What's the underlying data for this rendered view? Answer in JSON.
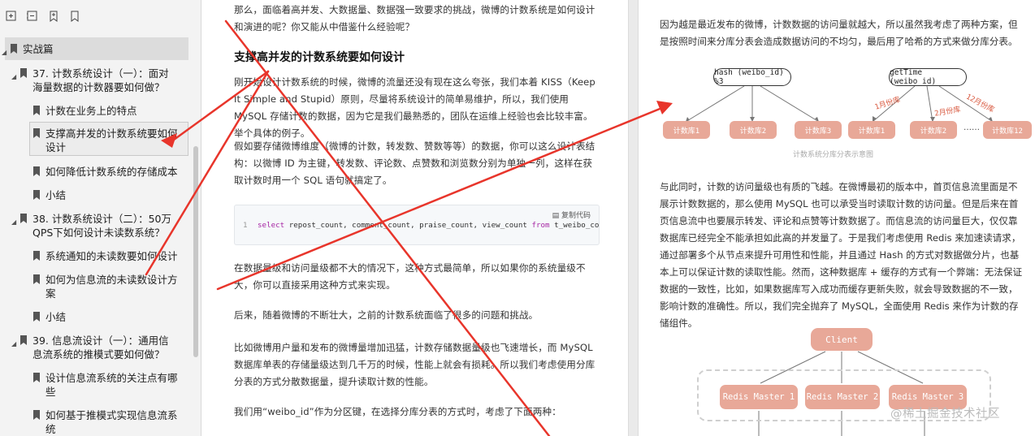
{
  "sidebar": {
    "toolbar": [
      "expand-all-icon",
      "collapse-all-icon",
      "add-bookmark-icon",
      "bookmark-icon"
    ],
    "section": "实战篇",
    "items": [
      {
        "label": "37. 计数系统设计（一）：面对海量数据的计数器要如何做？",
        "level": 1
      },
      {
        "label": "计数在业务上的特点",
        "level": 2
      },
      {
        "label": "支撑高并发的计数系统要如何设计",
        "level": 2,
        "selected": true
      },
      {
        "label": "如何降低计数系统的存储成本",
        "level": 2
      },
      {
        "label": "小结",
        "level": 2
      },
      {
        "label": "38. 计数系统设计（二）：50万QPS下如何设计未读数系统？",
        "level": 1
      },
      {
        "label": "系统通知的未读数要如何设计",
        "level": 2
      },
      {
        "label": "如何为信息流的未读数设计方案",
        "level": 2
      },
      {
        "label": "小结",
        "level": 2
      },
      {
        "label": "39. 信息流设计（一）：通用信息流系统的推模式要如何做？",
        "level": 1
      },
      {
        "label": "设计信息流系统的关注点有哪些",
        "level": 2
      },
      {
        "label": "如何基于推模式实现信息流系统",
        "level": 2
      }
    ]
  },
  "center": {
    "para_intro": "那么，面临着高并发、大数据量、数据强一致要求的挑战，微博的计数系统是如何设计和演进的呢？你又能从中借鉴什么经验呢？",
    "heading": "支撑高并发的计数系统要如何设计",
    "para1": "刚开始设计计数系统的时候，微博的流量还没有现在这么夸张，我们本着 KISS（Keep It Simple and Stupid）原则，尽量将系统设计的简单易维护，所以，我们使用 MySQL 存储计数的数据，因为它是我们最熟悉的，团队在运维上经验也会比较丰富。举个具体的例子。",
    "para2": "假如要存储微博维度（微博的计数，转发数、赞数等等）的数据，你可以这么设计表结构：以微博 ID 为主键，转发数、评论数、点赞数和浏览数分别为单独一列，这样在获取计数时用一个 SQL 语句就搞定了。",
    "code_copy": "复制代码",
    "code_line": "1",
    "code_parts": {
      "kw1": "select",
      "mid": " repost_count, comment_count, praise_count, view_count ",
      "kw2": "from",
      "tail": " t_weibo_count"
    },
    "para3": "在数据量级和访问量级都不大的情况下，这种方式最简单，所以如果你的系统量级不大，你可以直接采用这种方式来实现。",
    "para4": "后来，随着微博的不断壮大，之前的计数系统面临了很多的问题和挑战。",
    "para5": "比如微博用户量和发布的微博量增加迅猛，计数存储数据量级也飞速增长，而 MySQL 数据库单表的存储量级达到几千万的时候，性能上就会有损耗。所以我们考虑使用分库分表的方式分散数据量，提升读取计数的性能。",
    "para6": "我们用“weibo_id”作为分区键，在选择分库分表的方式时，考虑了下面两种："
  },
  "right": {
    "para1": "因为越是最近发布的微博，计数数据的访问量就越大，所以虽然我考虑了两种方案，但是按照时间来分库分表会造成数据访问的不均匀，最后用了哈希的方式来做分库分表。",
    "diagram": {
      "hash_node": "hash (weibo_id) %3",
      "time_node": "getTime (weibo_id)",
      "db_nodes": [
        "计数库1",
        "计数库2",
        "计数库3",
        "计数库1",
        "计数库2",
        "计数库12"
      ],
      "hw_labels": [
        "1月份库",
        "2月份库",
        "12月份库"
      ],
      "dots": "……",
      "caption": "计数系统分库分表示意图"
    },
    "para2": "与此同时，计数的访问量级也有质的飞越。在微博最初的版本中，首页信息流里面是不展示计数数据的，那么使用 MySQL 也可以承受当时读取计数的访问量。但是后来在首页信息流中也要展示转发、评论和点赞等计数数据了。而信息流的访问量巨大，仅仅靠数据库已经完全不能承担如此高的并发量了。于是我们考虑使用 Redis 来加速读请求，通过部署多个从节点来提升可用性和性能，并且通过 Hash 的方式对数据做分片，也基本上可以保证计数的读取性能。然而，这种数据库 + 缓存的方式有一个弊端：无法保证数据的一致性，比如，如果数据库写入成功而缓存更新失败，就会导致数据的不一致，影响计数的准确性。所以，我们完全抛弃了 MySQL，全面使用 Redis 来作为计数的存储组件。",
    "client": "Client",
    "redis_nodes": [
      "Redis Master 1",
      "Redis Master 2",
      "Redis Master 3"
    ],
    "watermark": "@稀土掘金技术社区"
  },
  "colors": {
    "node_fill": "#e8a898",
    "annotation": "#e8352b",
    "handwriting": "#d8573d"
  }
}
